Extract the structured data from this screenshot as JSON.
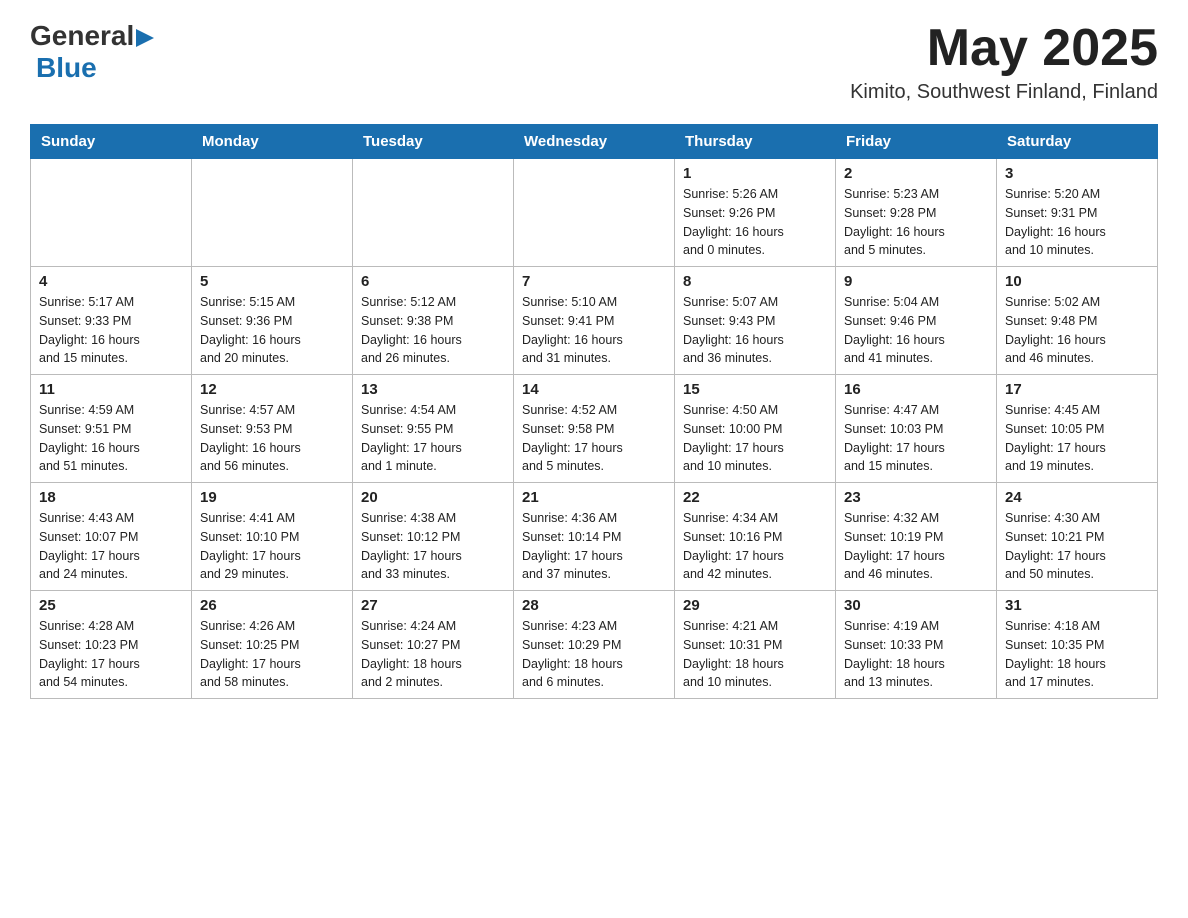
{
  "header": {
    "logo_general": "General",
    "logo_blue": "Blue",
    "month_year": "May 2025",
    "location": "Kimito, Southwest Finland, Finland"
  },
  "weekdays": [
    "Sunday",
    "Monday",
    "Tuesday",
    "Wednesday",
    "Thursday",
    "Friday",
    "Saturday"
  ],
  "weeks": [
    [
      {
        "day": "",
        "info": ""
      },
      {
        "day": "",
        "info": ""
      },
      {
        "day": "",
        "info": ""
      },
      {
        "day": "",
        "info": ""
      },
      {
        "day": "1",
        "info": "Sunrise: 5:26 AM\nSunset: 9:26 PM\nDaylight: 16 hours\nand 0 minutes."
      },
      {
        "day": "2",
        "info": "Sunrise: 5:23 AM\nSunset: 9:28 PM\nDaylight: 16 hours\nand 5 minutes."
      },
      {
        "day": "3",
        "info": "Sunrise: 5:20 AM\nSunset: 9:31 PM\nDaylight: 16 hours\nand 10 minutes."
      }
    ],
    [
      {
        "day": "4",
        "info": "Sunrise: 5:17 AM\nSunset: 9:33 PM\nDaylight: 16 hours\nand 15 minutes."
      },
      {
        "day": "5",
        "info": "Sunrise: 5:15 AM\nSunset: 9:36 PM\nDaylight: 16 hours\nand 20 minutes."
      },
      {
        "day": "6",
        "info": "Sunrise: 5:12 AM\nSunset: 9:38 PM\nDaylight: 16 hours\nand 26 minutes."
      },
      {
        "day": "7",
        "info": "Sunrise: 5:10 AM\nSunset: 9:41 PM\nDaylight: 16 hours\nand 31 minutes."
      },
      {
        "day": "8",
        "info": "Sunrise: 5:07 AM\nSunset: 9:43 PM\nDaylight: 16 hours\nand 36 minutes."
      },
      {
        "day": "9",
        "info": "Sunrise: 5:04 AM\nSunset: 9:46 PM\nDaylight: 16 hours\nand 41 minutes."
      },
      {
        "day": "10",
        "info": "Sunrise: 5:02 AM\nSunset: 9:48 PM\nDaylight: 16 hours\nand 46 minutes."
      }
    ],
    [
      {
        "day": "11",
        "info": "Sunrise: 4:59 AM\nSunset: 9:51 PM\nDaylight: 16 hours\nand 51 minutes."
      },
      {
        "day": "12",
        "info": "Sunrise: 4:57 AM\nSunset: 9:53 PM\nDaylight: 16 hours\nand 56 minutes."
      },
      {
        "day": "13",
        "info": "Sunrise: 4:54 AM\nSunset: 9:55 PM\nDaylight: 17 hours\nand 1 minute."
      },
      {
        "day": "14",
        "info": "Sunrise: 4:52 AM\nSunset: 9:58 PM\nDaylight: 17 hours\nand 5 minutes."
      },
      {
        "day": "15",
        "info": "Sunrise: 4:50 AM\nSunset: 10:00 PM\nDaylight: 17 hours\nand 10 minutes."
      },
      {
        "day": "16",
        "info": "Sunrise: 4:47 AM\nSunset: 10:03 PM\nDaylight: 17 hours\nand 15 minutes."
      },
      {
        "day": "17",
        "info": "Sunrise: 4:45 AM\nSunset: 10:05 PM\nDaylight: 17 hours\nand 19 minutes."
      }
    ],
    [
      {
        "day": "18",
        "info": "Sunrise: 4:43 AM\nSunset: 10:07 PM\nDaylight: 17 hours\nand 24 minutes."
      },
      {
        "day": "19",
        "info": "Sunrise: 4:41 AM\nSunset: 10:10 PM\nDaylight: 17 hours\nand 29 minutes."
      },
      {
        "day": "20",
        "info": "Sunrise: 4:38 AM\nSunset: 10:12 PM\nDaylight: 17 hours\nand 33 minutes."
      },
      {
        "day": "21",
        "info": "Sunrise: 4:36 AM\nSunset: 10:14 PM\nDaylight: 17 hours\nand 37 minutes."
      },
      {
        "day": "22",
        "info": "Sunrise: 4:34 AM\nSunset: 10:16 PM\nDaylight: 17 hours\nand 42 minutes."
      },
      {
        "day": "23",
        "info": "Sunrise: 4:32 AM\nSunset: 10:19 PM\nDaylight: 17 hours\nand 46 minutes."
      },
      {
        "day": "24",
        "info": "Sunrise: 4:30 AM\nSunset: 10:21 PM\nDaylight: 17 hours\nand 50 minutes."
      }
    ],
    [
      {
        "day": "25",
        "info": "Sunrise: 4:28 AM\nSunset: 10:23 PM\nDaylight: 17 hours\nand 54 minutes."
      },
      {
        "day": "26",
        "info": "Sunrise: 4:26 AM\nSunset: 10:25 PM\nDaylight: 17 hours\nand 58 minutes."
      },
      {
        "day": "27",
        "info": "Sunrise: 4:24 AM\nSunset: 10:27 PM\nDaylight: 18 hours\nand 2 minutes."
      },
      {
        "day": "28",
        "info": "Sunrise: 4:23 AM\nSunset: 10:29 PM\nDaylight: 18 hours\nand 6 minutes."
      },
      {
        "day": "29",
        "info": "Sunrise: 4:21 AM\nSunset: 10:31 PM\nDaylight: 18 hours\nand 10 minutes."
      },
      {
        "day": "30",
        "info": "Sunrise: 4:19 AM\nSunset: 10:33 PM\nDaylight: 18 hours\nand 13 minutes."
      },
      {
        "day": "31",
        "info": "Sunrise: 4:18 AM\nSunset: 10:35 PM\nDaylight: 18 hours\nand 17 minutes."
      }
    ]
  ]
}
